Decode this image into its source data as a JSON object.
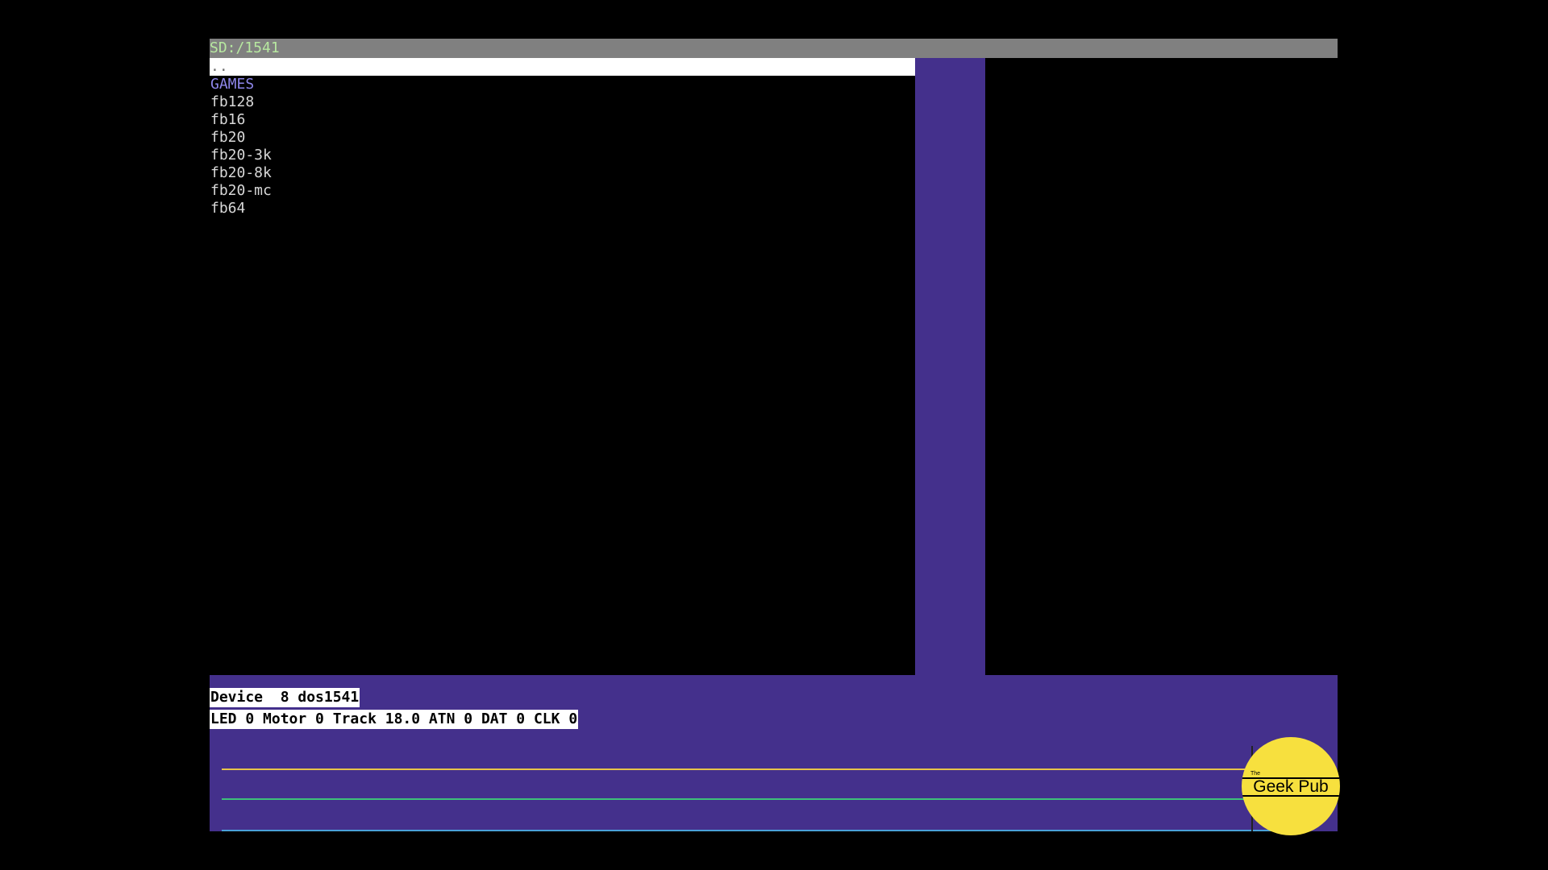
{
  "colors": {
    "background": "#000000",
    "path_bar": "#808080",
    "path_text": "#b7e8a0",
    "panel": "#44308c",
    "directory": "#8e86ea",
    "file": "#d8d8d8",
    "atn_trace": "#e8c44a",
    "dat_trace": "#3ec07a",
    "clk_trace": "#4aa0d8",
    "logo": "#f7e03e"
  },
  "browser": {
    "path": "SD:/1541",
    "entries": [
      {
        "name": "..",
        "kind": "parent",
        "selected": true
      },
      {
        "name": "GAMES",
        "kind": "directory",
        "selected": false
      },
      {
        "name": "fb128",
        "kind": "file",
        "selected": false
      },
      {
        "name": "fb16",
        "kind": "file",
        "selected": false
      },
      {
        "name": "fb20",
        "kind": "file",
        "selected": false
      },
      {
        "name": "fb20-3k",
        "kind": "file",
        "selected": false
      },
      {
        "name": "fb20-8k",
        "kind": "file",
        "selected": false
      },
      {
        "name": "fb20-mc",
        "kind": "file",
        "selected": false
      },
      {
        "name": "fb64",
        "kind": "file",
        "selected": false
      }
    ]
  },
  "status": {
    "device_line": "Device  8 dos1541",
    "iec_line": "LED 0 Motor 0 Track 18.0 ATN 0 DAT 0 CLK 0"
  },
  "logo": {
    "small": "The",
    "name": "Geek Pub"
  }
}
